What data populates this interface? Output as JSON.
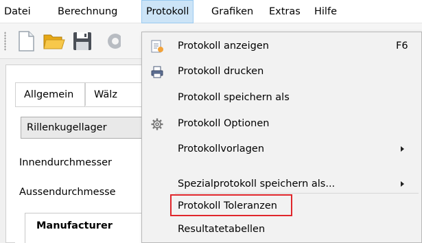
{
  "menubar": {
    "items": [
      {
        "label": "Datei"
      },
      {
        "label": "Berechnung"
      },
      {
        "label": "Protokoll"
      },
      {
        "label": "Grafiken"
      },
      {
        "label": "Extras"
      },
      {
        "label": "Hilfe"
      }
    ]
  },
  "toolbar": {
    "icons": [
      "new-document-icon",
      "open-folder-icon",
      "save-icon",
      "gear-icon"
    ]
  },
  "tabs": [
    {
      "label": "Allgemein"
    },
    {
      "label": "Wälz"
    }
  ],
  "form": {
    "bearing_type": "Rillenkugellager",
    "inner_diameter_label": "Innendurchmesser",
    "outer_diameter_label": "Aussendurchmesse",
    "table_header": "Manufacturer"
  },
  "protokoll_menu": {
    "items": [
      {
        "label": "Protokoll anzeigen",
        "shortcut": "F6",
        "icon": "report-view-icon"
      },
      {
        "label": "Protokoll drucken",
        "icon": "printer-icon"
      },
      {
        "label": "Protokoll speichern als"
      },
      {
        "label": "Protokoll Optionen",
        "icon": "gear-icon"
      },
      {
        "label": "Protokollvorlagen",
        "submenu": true
      },
      {
        "label": "Spezialprotokoll speichern als...",
        "submenu": true
      },
      {
        "label": "Protokoll Toleranzen",
        "highlighted": true
      },
      {
        "label": "Resultatetabellen"
      }
    ]
  },
  "colors": {
    "menu_active_bg": "#cce4f7",
    "menu_active_border": "#99c9ef",
    "highlight_border": "#e0262b"
  }
}
